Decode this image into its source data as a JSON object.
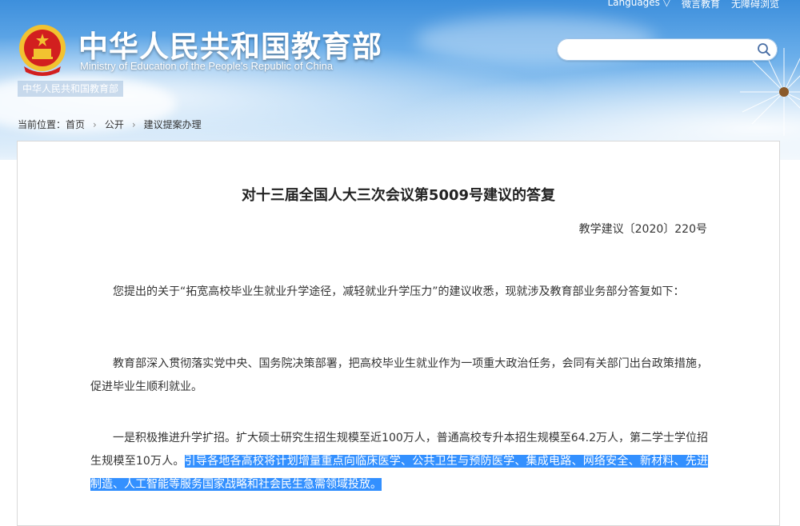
{
  "topbar": {
    "languages": "Languages ▽",
    "weibo": "微言教育",
    "accessibility": "无障碍浏览"
  },
  "header": {
    "title": "中华人民共和国教育部",
    "subtitle": "Ministry of Education of the People's Republic of China",
    "tag": "中华人民共和国教育部"
  },
  "search": {
    "value": "",
    "placeholder": ""
  },
  "breadcrumb": {
    "label": "当前位置：",
    "items": [
      "首页",
      "公开",
      "建议提案办理"
    ]
  },
  "article": {
    "title": "对十三届全国人大三次会议第5009号建议的答复",
    "doc_number": "教学建议〔2020〕220号",
    "para1": "您提出的关于“拓宽高校毕业生就业升学途径，减轻就业升学压力”的建议收悉，现就涉及教育部业务部分答复如下：",
    "para2": "教育部深入贯彻落实党中央、国务院决策部署，把高校毕业生就业作为一项重大政治任务，会同有关部门出台政策措施，促进毕业生顺利就业。",
    "para3_plain": "一是积极推进升学扩招。扩大硕士研究生招生规模至近100万人，普通高校专升本招生规模至64.2万人，第二学士学位招生规模至10万人。",
    "para3_highlight": "引导各地各高校将计划增量重点向临床医学、公共卫生与预防医学、集成电路、网络安全、新材料、先进制造、人工智能等服务国家战略和社会民生急需领域投放。"
  },
  "colors": {
    "sky_top": "#3d8fdc",
    "selection": "#3390ff",
    "emblem_red": "#d21f1f",
    "emblem_gold": "#f2c230"
  }
}
